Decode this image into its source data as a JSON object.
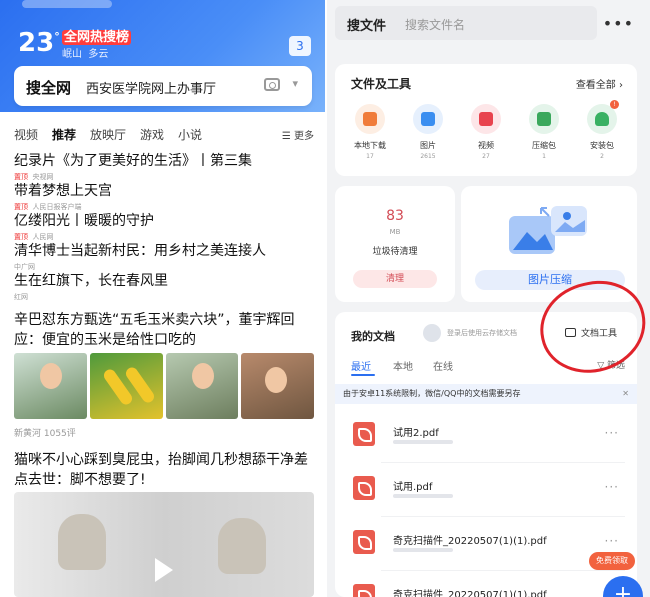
{
  "left": {
    "weather": {
      "temp": "23",
      "unit": "°",
      "hot_label": "全网热搜榜",
      "location": "岷山",
      "condition": "多云",
      "msg_count": "3"
    },
    "search": {
      "brand": "搜全网",
      "query": "西安医学院网上办事厅"
    },
    "tabs": [
      "视频",
      "推荐",
      "放映厅",
      "游戏",
      "小说"
    ],
    "more": "更多",
    "news": [
      {
        "title": "纪录片《为了更美好的生活》丨第三集",
        "tag": "置顶",
        "source": "央视网"
      },
      {
        "title": "带着梦想上天宫",
        "tag": "置顶",
        "source": "人民日报客户端"
      },
      {
        "title": "亿缕阳光丨暖暖的守护",
        "tag": "置顶",
        "source": "人民网"
      },
      {
        "title": "清华博士当起新村民：用乡村之美连接人",
        "tag": "",
        "source": "中广网"
      },
      {
        "title": "生在红旗下，长在春风里",
        "tag": "",
        "source": "红网"
      }
    ],
    "story1": {
      "title": "辛巴怼东方甄选“五毛玉米卖六块”，董宇辉回应：便宜的玉米是给性口吃的",
      "meta": "新黄河 1055评"
    },
    "story2": {
      "title": "猫咪不小心踩到臭屁虫，抬脚闻几秒想舔干净差点去世：脚不想要了!"
    }
  },
  "right": {
    "search": {
      "label": "搜文件",
      "placeholder": "搜索文件名"
    },
    "tools": {
      "title": "文件及工具",
      "view_all": "查看全部",
      "items": [
        {
          "label": "本地下载",
          "count": "17",
          "color": "#f07c3a"
        },
        {
          "label": "图片",
          "count": "2615",
          "color": "#3a8ef0"
        },
        {
          "label": "视频",
          "count": "27",
          "color": "#e8434e"
        },
        {
          "label": "压缩包",
          "count": "1",
          "color": "#3aa85c"
        },
        {
          "label": "安装包",
          "count": "2",
          "color": "#39b163"
        }
      ]
    },
    "clean": {
      "value": "83",
      "unit": "MB",
      "label": "垃圾待清理",
      "button": "清理"
    },
    "compress": {
      "button": "图片压缩"
    },
    "docs": {
      "title": "我的文档",
      "login": "登录后使用云存储文档",
      "tool": "文档工具",
      "tabs": [
        "最近",
        "本地",
        "在线"
      ],
      "filter": "筛选",
      "notice": "由于安卓11系统限制，微信/QQ中的文档需要另存",
      "files": [
        "试用2.pdf",
        "试用.pdf",
        "奇克扫描件_20220507(1)(1).pdf",
        "奇克扫描件_20220507(1)(1).pdf"
      ]
    },
    "float_tag": "免费领取",
    "fab": "+"
  }
}
